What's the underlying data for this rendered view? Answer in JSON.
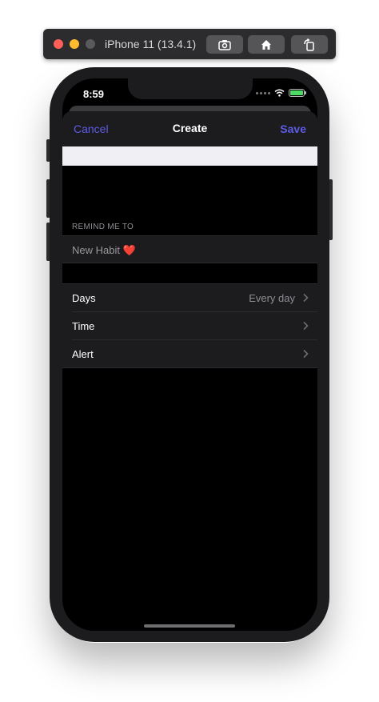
{
  "simulator": {
    "title": "iPhone 11 (13.4.1)"
  },
  "status_bar": {
    "time": "8:59"
  },
  "nav": {
    "cancel": "Cancel",
    "title": "Create",
    "save": "Save"
  },
  "remind": {
    "header": "REMIND ME TO",
    "habit_value": "New Habit ❤️"
  },
  "settings": {
    "days_label": "Days",
    "days_value": "Every day",
    "time_label": "Time",
    "alert_label": "Alert"
  },
  "colors": {
    "accent": "#5e5ce6",
    "cell_background": "#1c1c1e",
    "screen_background": "#000000"
  }
}
